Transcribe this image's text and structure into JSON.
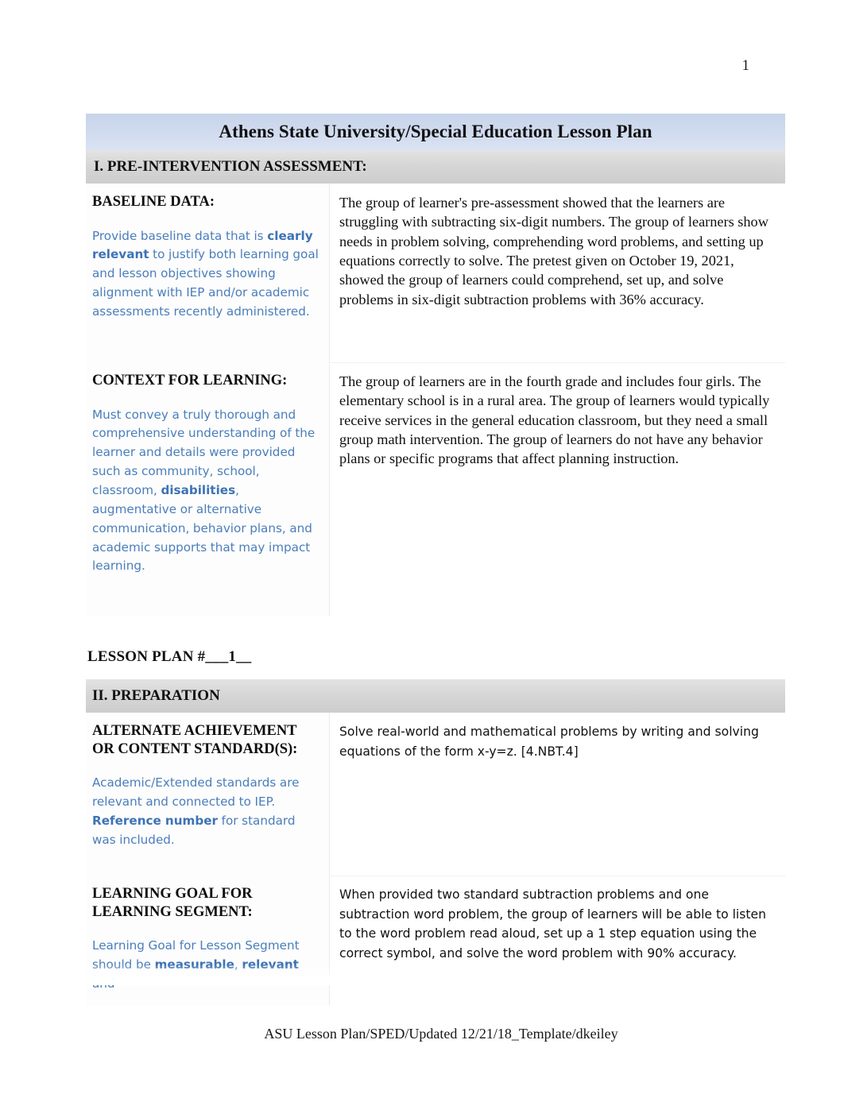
{
  "page": {
    "number": "1",
    "footer": "ASU Lesson Plan/SPED/Updated 12/21/18_Template/dkeiley",
    "title": "Athens State University/Special Education Lesson Plan",
    "accent_blue": "#4a7ebb",
    "title_band_color": "#ccd8ed",
    "section_band_color": "#d6d6d6"
  },
  "section_one": {
    "heading": "I.  PRE-INTERVENTION ASSESSMENT:",
    "rows": [
      {
        "label": "BASELINE DATA:",
        "guidance_parts": [
          {
            "text": "Provide baseline data that is ",
            "bold": false
          },
          {
            "text": "clearly relevant",
            "bold": true
          },
          {
            "text": " to justify both learning goal and lesson objectives showing alignment with IEP and/or academic assessments recently administered.",
            "bold": false
          }
        ],
        "guidance_plain": "Provide baseline data that is clearly relevant to justify both learning goal and lesson objectives showing alignment with IEP and/or academic assessments recently administered.",
        "answer": "The group of learner's pre-assessment showed that the learners are struggling with subtracting six-digit numbers. The group of learners show needs in problem solving, comprehending word problems, and setting up equations correctly to solve. The pretest given on October 19, 2021, showed the group of learners could comprehend, set up, and solve problems in six-digit subtraction problems with 36% accuracy."
      },
      {
        "label": "CONTEXT FOR LEARNING:",
        "guidance_plain": "Must convey a truly thorough and comprehensive understanding of the learner and details were provided such as community, school, classroom, disabilities, augmentative or alternative communication, behavior plans, and academic supports that may impact learning.",
        "answer": "The group of learners are in the fourth grade and includes four girls. The elementary school is in a rural area. The group of learners would typically receive services in the general education classroom, but they need a small group math intervention. The group of learners do not have any behavior plans or specific programs that affect planning instruction."
      }
    ]
  },
  "lesson_plan_line": "LESSON PLAN #___1__",
  "section_two": {
    "heading": "II. PREPARATION",
    "rows": [
      {
        "label": "ALTERNATE ACHIEVEMENT OR CONTENT STANDARD(S):",
        "guidance_plain": "Academic/Extended standards are relevant and connected to IEP. Reference number for standard was included.",
        "answer": "Solve real-world and mathematical problems by writing and solving equations of the form x-y=z. [4.NBT.4]"
      },
      {
        "label": "LEARNING GOAL FOR LEARNING SEGMENT:",
        "guidance_plain": "Learning Goal for Lesson Segment should be  measurable, relevant and",
        "answer": "When provided two standard subtraction problems and one subtraction word problem, the group of learners will be able to listen to the word problem read aloud, set up a 1 step equation using the correct symbol, and solve the word problem with 90% accuracy."
      }
    ]
  }
}
